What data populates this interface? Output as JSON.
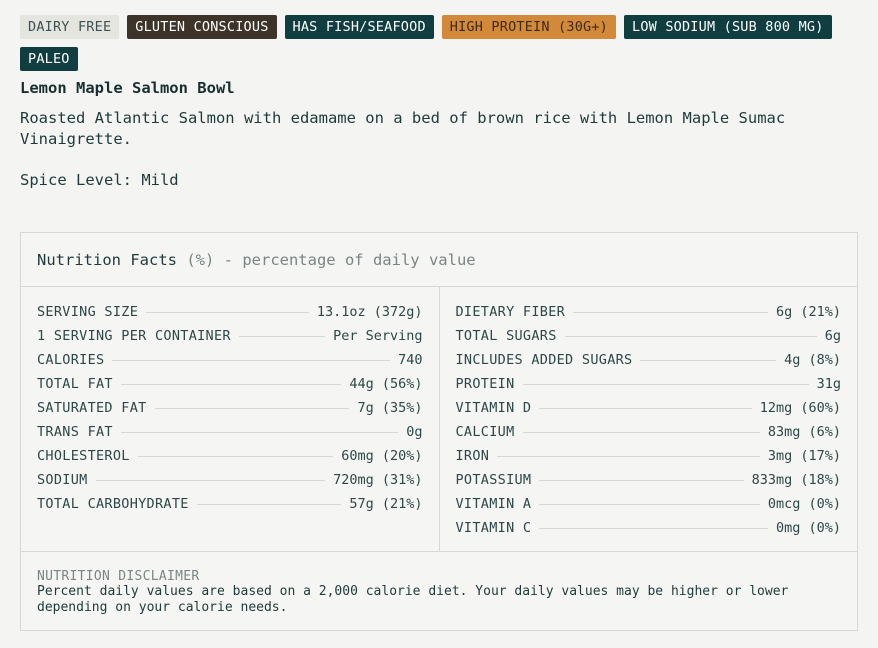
{
  "tags": [
    {
      "label": "DAIRY FREE",
      "bg": "#e4e5df",
      "fg": "#3f5251"
    },
    {
      "label": "GLUTEN CONSCIOUS",
      "bg": "#3d3328",
      "fg": "#ffffff"
    },
    {
      "label": "HAS FISH/SEAFOOD",
      "bg": "#0f3d40",
      "fg": "#ffffff"
    },
    {
      "label": "HIGH PROTEIN (30G+)",
      "bg": "#d3893a",
      "fg": "#3e2a16"
    },
    {
      "label": "LOW SODIUM (SUB 800 MG)",
      "bg": "#0f3d40",
      "fg": "#ffffff"
    },
    {
      "label": "PALEO",
      "bg": "#0f3d40",
      "fg": "#ffffff"
    }
  ],
  "product": {
    "title": "Lemon Maple Salmon Bowl",
    "description": "Roasted Atlantic Salmon with edamame on a bed of brown rice with Lemon Maple Sumac Vinaigrette.",
    "spice": "Spice Level: Mild"
  },
  "nutrition": {
    "heading": "Nutrition Facts",
    "subheading": "(%) - percentage of daily value",
    "left": [
      {
        "label": "SERVING SIZE",
        "value": "13.1oz (372g)"
      },
      {
        "label": "1 SERVING PER CONTAINER",
        "value": "Per Serving"
      },
      {
        "label": "CALORIES",
        "value": "740"
      },
      {
        "label": "TOTAL FAT",
        "value": "44g (56%)"
      },
      {
        "label": "SATURATED FAT",
        "value": "7g (35%)"
      },
      {
        "label": "TRANS FAT",
        "value": "0g"
      },
      {
        "label": "CHOLESTEROL",
        "value": "60mg (20%)"
      },
      {
        "label": "SODIUM",
        "value": "720mg (31%)"
      },
      {
        "label": "TOTAL CARBOHYDRATE",
        "value": "57g (21%)"
      }
    ],
    "right": [
      {
        "label": "DIETARY FIBER",
        "value": "6g (21%)"
      },
      {
        "label": "TOTAL SUGARS",
        "value": "6g"
      },
      {
        "label": "INCLUDES ADDED SUGARS",
        "value": "4g (8%)"
      },
      {
        "label": "PROTEIN",
        "value": "31g"
      },
      {
        "label": "VITAMIN D",
        "value": "12mg (60%)"
      },
      {
        "label": "CALCIUM",
        "value": "83mg (6%)"
      },
      {
        "label": "IRON",
        "value": "3mg (17%)"
      },
      {
        "label": "POTASSIUM",
        "value": "833mg (18%)"
      },
      {
        "label": "VITAMIN A",
        "value": "0mcg (0%)"
      },
      {
        "label": "VITAMIN C",
        "value": "0mg (0%)"
      }
    ],
    "disclaimer_title": "NUTRITION DISCLAIMER",
    "disclaimer_text": "Percent daily values are based on a 2,000 calorie diet. Your daily values may be higher or lower depending on your calorie needs."
  }
}
